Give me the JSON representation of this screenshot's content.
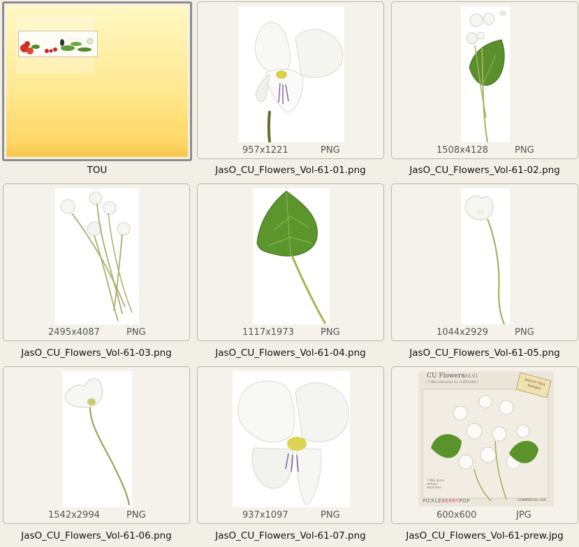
{
  "items": [
    {
      "name": "TOU",
      "dims": "",
      "type": ""
    },
    {
      "name": "JasO_CU_Flowers_Vol-61-01.png",
      "dims": "957x1221",
      "type": "PNG"
    },
    {
      "name": "JasO_CU_Flowers_Vol-61-02.png",
      "dims": "1508x4128",
      "type": "PNG"
    },
    {
      "name": "JasO_CU_Flowers_Vol-61-03.png",
      "dims": "2495x4087",
      "type": "PNG"
    },
    {
      "name": "JasO_CU_Flowers_Vol-61-04.png",
      "dims": "1117x1973",
      "type": "PNG"
    },
    {
      "name": "JasO_CU_Flowers_Vol-61-05.png",
      "dims": "1044x2929",
      "type": "PNG"
    },
    {
      "name": "JasO_CU_Flowers_Vol-61-06.png",
      "dims": "1542x2994",
      "type": "PNG"
    },
    {
      "name": "JasO_CU_Flowers_Vol-61-07.png",
      "dims": "937x1097",
      "type": "PNG"
    },
    {
      "name": "JasO_CU_Flowers_Vol-61-prew.jpg",
      "dims": "600x600",
      "type": "JPG"
    }
  ],
  "preview": {
    "title": "CU Flowers",
    "volume": "Vol.61",
    "subtitle": "| 7 PNG elements for CU/PU/S4H |",
    "tag_line1": "Jasmin-Olya",
    "tag_line2": "Designs",
    "note_line1": "7 PNG items",
    "note_line2": "without",
    "note_line3": "duplicates",
    "brand_pickle": "PICKLE",
    "brand_berry": "BERRY",
    "brand_pop": "POP",
    "commercial": "COMMERCIAL USE"
  }
}
